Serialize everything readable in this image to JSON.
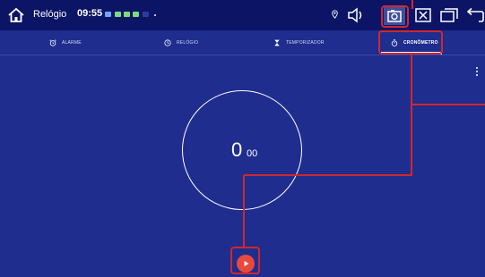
{
  "statusbar": {
    "app_title": "Relógio",
    "time": "09:55",
    "icons": [
      "home-icon",
      "notification-icons",
      "location-icon",
      "volume-icon",
      "screenshot-icon",
      "close-window-icon",
      "recent-apps-icon",
      "back-icon"
    ]
  },
  "tabs": [
    {
      "label": "ALARME",
      "icon": "alarm-icon"
    },
    {
      "label": "RELÓGIO",
      "icon": "clock-icon"
    },
    {
      "label": "TEMPORIZADOR",
      "icon": "hourglass-icon"
    },
    {
      "label": "CRONÔMETRO",
      "icon": "stopwatch-icon",
      "active": true
    }
  ],
  "stopwatch": {
    "main": "0",
    "centis": "00"
  },
  "colors": {
    "background": "#1f2d8e",
    "statusbar": "#0c1466",
    "accent": "#e9493a",
    "annotation": "#d0272e"
  }
}
